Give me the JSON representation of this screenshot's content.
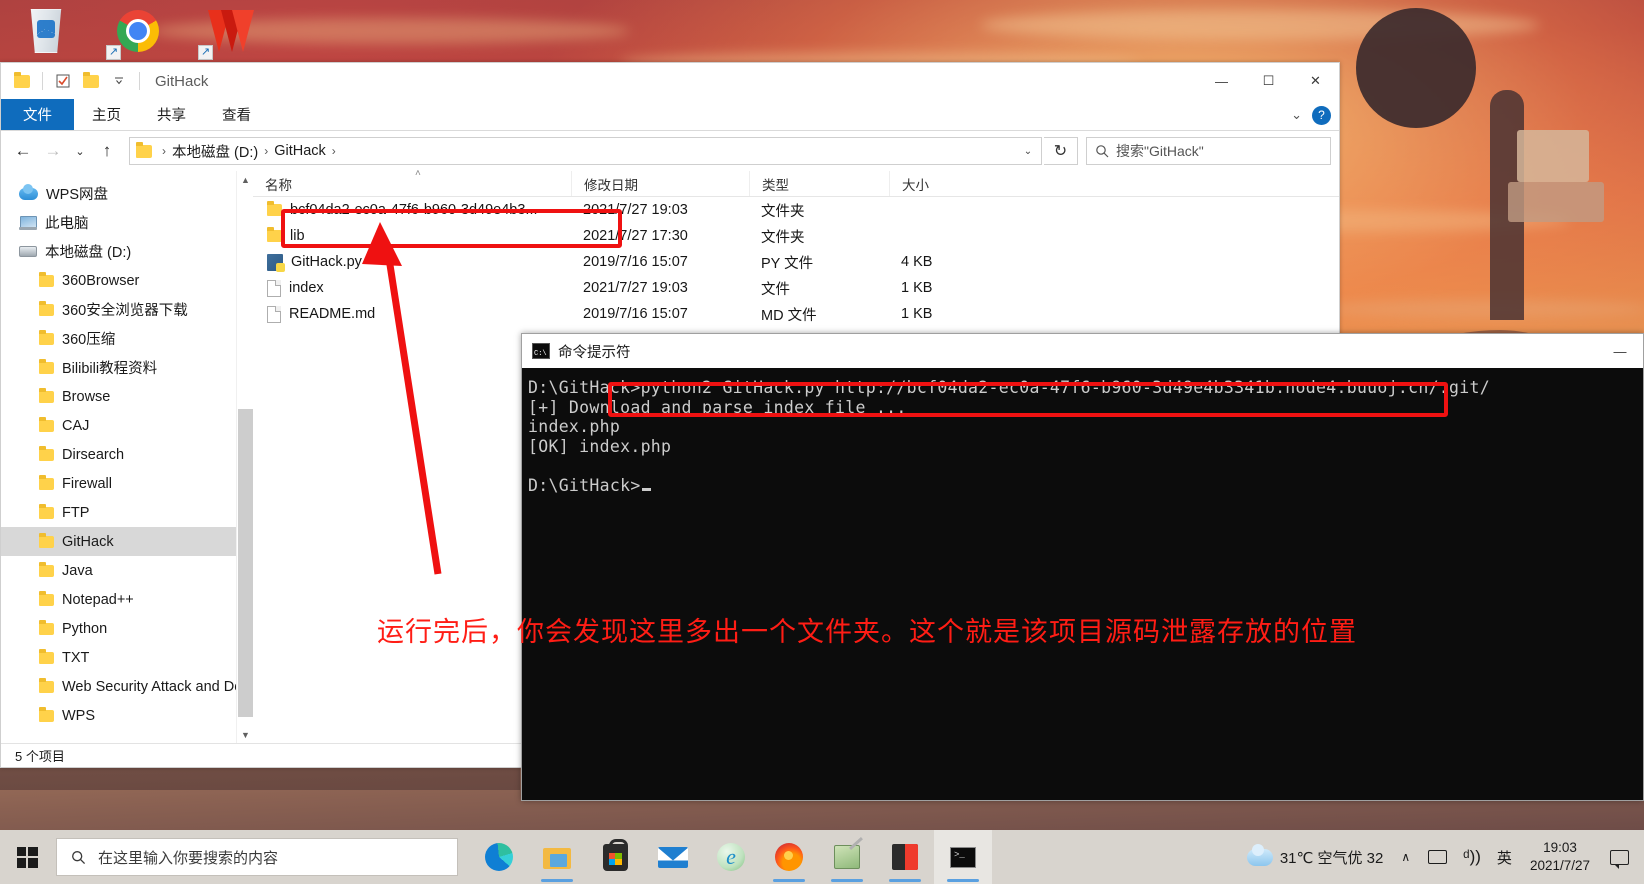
{
  "desktop": {
    "icons": [
      {
        "name": "recycle-bin",
        "label": ""
      },
      {
        "name": "google-chrome",
        "label": ""
      },
      {
        "name": "wps-office",
        "label": ""
      }
    ]
  },
  "explorer": {
    "title": "GitHack",
    "quick_access": [
      "folder-icon",
      "properties-icon",
      "new-folder-icon",
      "customize-chevron-icon"
    ],
    "window_controls": {
      "minimize": "—",
      "maximize": "☐",
      "close": "✕"
    },
    "ribbon_tabs": [
      {
        "label": "文件",
        "active": true
      },
      {
        "label": "主页",
        "active": false
      },
      {
        "label": "共享",
        "active": false
      },
      {
        "label": "查看",
        "active": false
      }
    ],
    "ribbon_right": {
      "collapse": "⌄",
      "help": "?"
    },
    "nav": {
      "back": "←",
      "forward": "→",
      "recent": "⌄",
      "up": "↑"
    },
    "breadcrumb": [
      "本地磁盘 (D:)",
      "GitHack"
    ],
    "address_dropdown": "⌄",
    "refresh": "↻",
    "search": {
      "placeholder": "搜索\"GitHack\"",
      "value": "",
      "icon": "search-icon"
    },
    "tree": [
      {
        "label": "WPS网盘",
        "icon": "cloud-icon",
        "indent": 0,
        "selected": false
      },
      {
        "label": "此电脑",
        "icon": "pc-icon",
        "indent": 0,
        "selected": false
      },
      {
        "label": "本地磁盘 (D:)",
        "icon": "drive-icon",
        "indent": 0,
        "selected": false
      },
      {
        "label": "360Browser",
        "icon": "folder-icon",
        "indent": 1,
        "selected": false
      },
      {
        "label": "360安全浏览器下载",
        "icon": "folder-icon",
        "indent": 1,
        "selected": false
      },
      {
        "label": "360压缩",
        "icon": "folder-icon",
        "indent": 1,
        "selected": false
      },
      {
        "label": "Bilibili教程资料",
        "icon": "folder-icon",
        "indent": 1,
        "selected": false
      },
      {
        "label": "Browse",
        "icon": "folder-icon",
        "indent": 1,
        "selected": false
      },
      {
        "label": "CAJ",
        "icon": "folder-icon",
        "indent": 1,
        "selected": false
      },
      {
        "label": "Dirsearch",
        "icon": "folder-icon",
        "indent": 1,
        "selected": false
      },
      {
        "label": "Firewall",
        "icon": "folder-icon",
        "indent": 1,
        "selected": false
      },
      {
        "label": "FTP",
        "icon": "folder-icon",
        "indent": 1,
        "selected": false
      },
      {
        "label": "GitHack",
        "icon": "folder-icon",
        "indent": 1,
        "selected": true
      },
      {
        "label": "Java",
        "icon": "folder-icon",
        "indent": 1,
        "selected": false
      },
      {
        "label": "Notepad++",
        "icon": "folder-icon",
        "indent": 1,
        "selected": false
      },
      {
        "label": "Python",
        "icon": "folder-icon",
        "indent": 1,
        "selected": false
      },
      {
        "label": "TXT",
        "icon": "folder-icon",
        "indent": 1,
        "selected": false
      },
      {
        "label": "Web Security Attack and De",
        "icon": "folder-icon",
        "indent": 1,
        "selected": false
      },
      {
        "label": "WPS",
        "icon": "folder-icon",
        "indent": 1,
        "selected": false
      }
    ],
    "columns": [
      "名称",
      "修改日期",
      "类型",
      "大小"
    ],
    "sort_indicator": "˄",
    "files": [
      {
        "name": "bcf04da2-ec0a-47f6-b960-3d49e4b3...",
        "date": "2021/7/27 19:03",
        "type": "文件夹",
        "size": "",
        "icon": "folder-icon"
      },
      {
        "name": "lib",
        "date": "2021/7/27 17:30",
        "type": "文件夹",
        "size": "",
        "icon": "folder-icon"
      },
      {
        "name": "GitHack.py",
        "date": "2019/7/16 15:07",
        "type": "PY 文件",
        "size": "4 KB",
        "icon": "python-file-icon"
      },
      {
        "name": "index",
        "date": "2021/7/27 19:03",
        "type": "文件",
        "size": "1 KB",
        "icon": "file-icon"
      },
      {
        "name": "README.md",
        "date": "2019/7/16 15:07",
        "type": "MD 文件",
        "size": "1 KB",
        "icon": "file-icon"
      }
    ],
    "status": "5 个项目"
  },
  "cmd": {
    "title": "命令提示符",
    "icon": "cmd-icon",
    "minimize": "—",
    "lines": [
      "D:\\GitHack>python2 GitHack.py http://bcf04da2-ec0a-47f6-b960-3d49e4b3341b.node4.buuoj.cn/.git/",
      "[+] Download and parse index file ...",
      "index.php",
      "[OK] index.php",
      "",
      "D:\\GitHack>"
    ]
  },
  "annotations": {
    "highlight_color": "#ef1111",
    "text": "运行完后，你会发现这里多出一个文件夹。这个就是该项目源码泄露存放的位置",
    "arrow_name": "red-arrow-to-new-folder"
  },
  "taskbar": {
    "start_label": "start-button",
    "search_placeholder": "在这里输入你要搜索的内容",
    "search_value": "",
    "apps": [
      {
        "name": "microsoft-edge",
        "running": false
      },
      {
        "name": "file-explorer",
        "running": true
      },
      {
        "name": "microsoft-store",
        "running": false
      },
      {
        "name": "mail",
        "running": false
      },
      {
        "name": "internet-explorer",
        "running": false
      },
      {
        "name": "firefox",
        "running": true
      },
      {
        "name": "notepad-plus-plus",
        "running": true
      },
      {
        "name": "reading-app",
        "running": true
      },
      {
        "name": "command-prompt",
        "running": true
      }
    ],
    "tray": {
      "weather": "31℃ 空气优 32",
      "chevron": "∧",
      "network": "network-icon",
      "volume": "ᵈ))",
      "ime": "英",
      "time": "19:03",
      "date": "2021/7/27",
      "action_center": "notification-icon"
    }
  }
}
